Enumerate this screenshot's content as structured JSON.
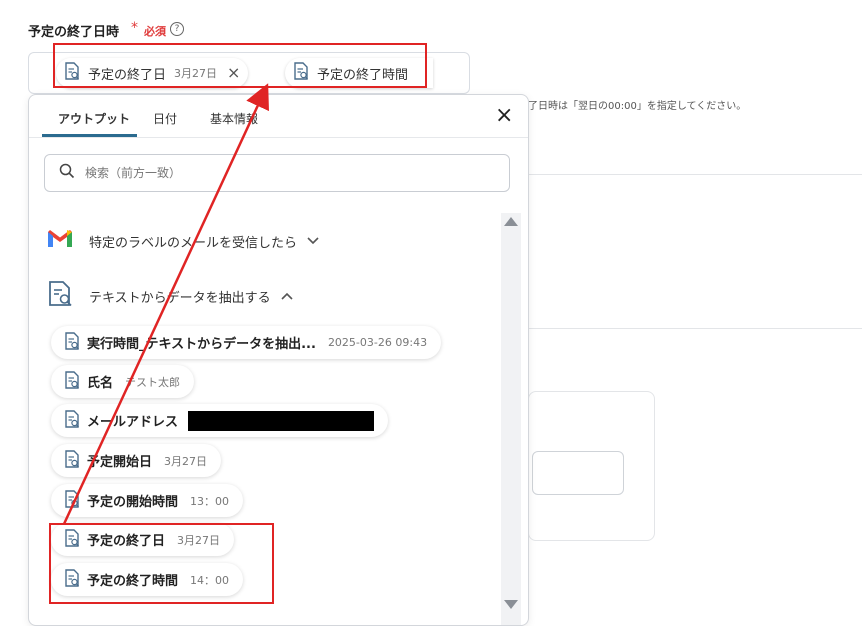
{
  "field": {
    "label": "予定の終了日時",
    "required_mark": "*",
    "required_text": "必須",
    "help": "?",
    "chips": [
      {
        "label": "予定の終了日",
        "value": "3月27日",
        "remove": "×"
      },
      {
        "label": "予定の終了時間"
      }
    ],
    "hint": "了日時は「翌日の00:00」を指定してください。"
  },
  "popup": {
    "tabs": [
      "アウトプット",
      "日付",
      "基本情報"
    ],
    "active_tab": "アウトプット",
    "close": "×",
    "search_placeholder": "検索（前方一致）",
    "sections": [
      {
        "title": "特定のラベルのメールを受信したら",
        "expanded": false,
        "icon": "gmail-icon"
      },
      {
        "title": "テキストからデータを抽出する",
        "expanded": true,
        "icon": "document-search-icon"
      }
    ],
    "items": [
      {
        "label": "実行時間_テキストからデータを抽出...",
        "value": "2025-03-26 09:43"
      },
      {
        "label": "氏名",
        "value": "テスト太郎"
      },
      {
        "label": "メールアドレス",
        "value": ""
      },
      {
        "label": "予定開始日",
        "value": "3月27日"
      },
      {
        "label": "予定の開始時間",
        "value": "13：00"
      },
      {
        "label": "予定の終了日",
        "value": "3月27日"
      },
      {
        "label": "予定の終了時間",
        "value": "14：00"
      }
    ]
  },
  "colors": {
    "accent": "#2b6b8f",
    "required": "#e03a3a",
    "annotation": "#e02424"
  }
}
